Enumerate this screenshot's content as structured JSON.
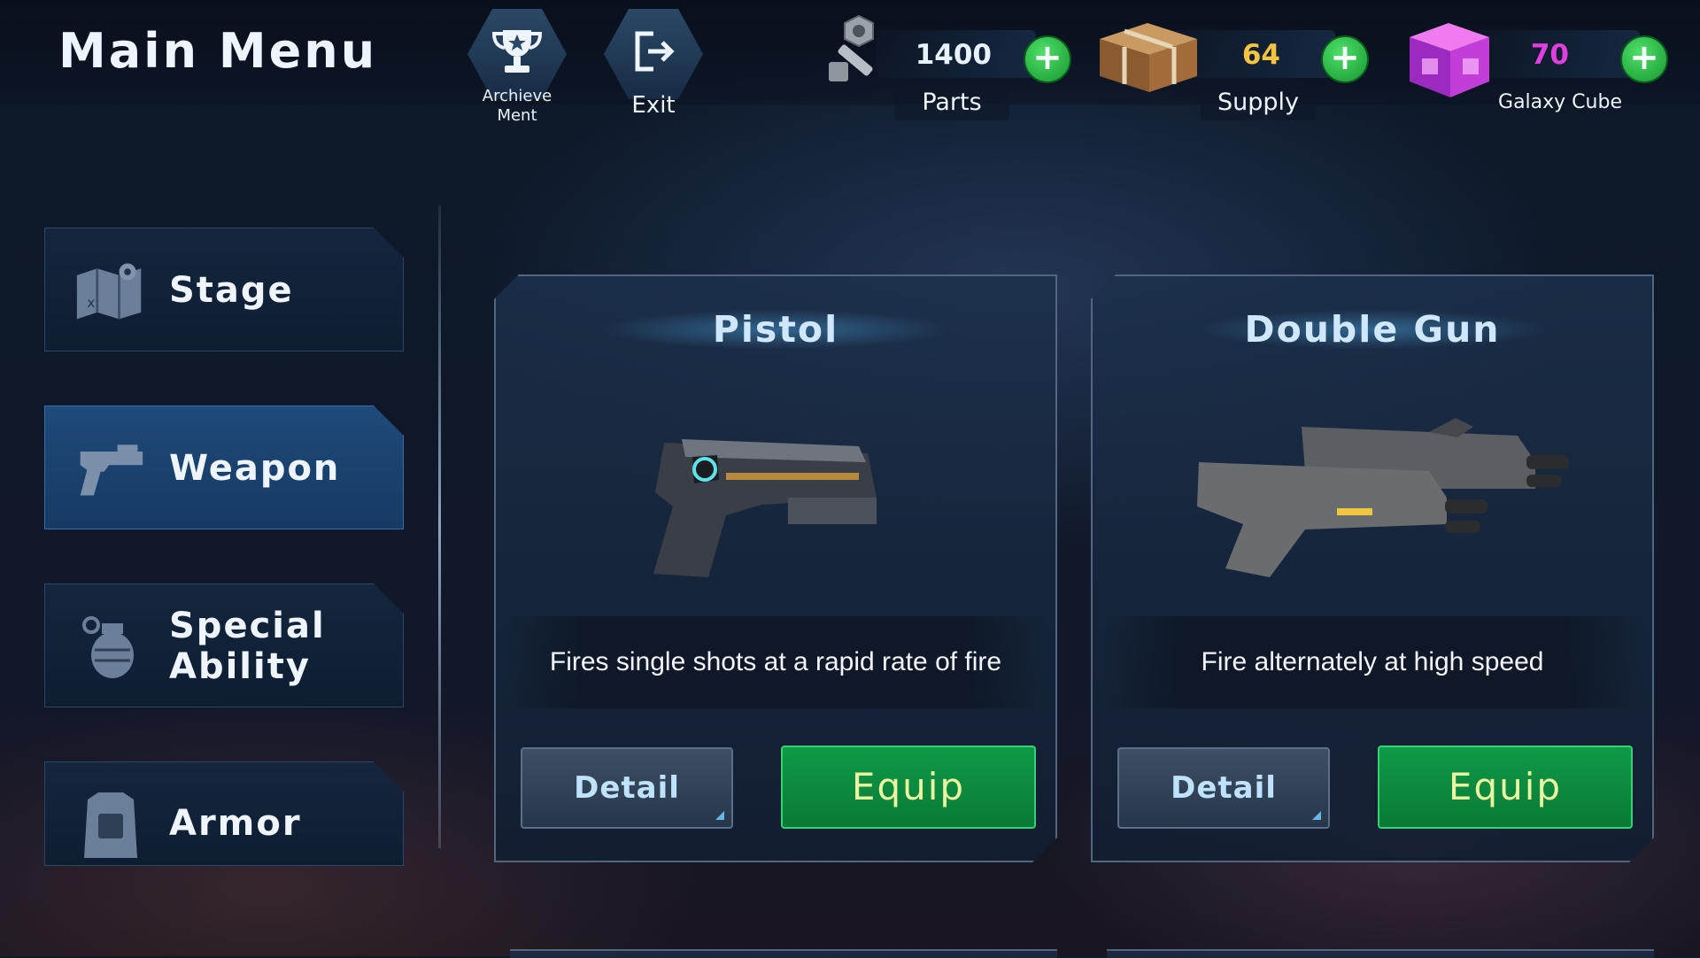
{
  "header": {
    "title": "Main Menu"
  },
  "top_buttons": [
    {
      "label": "Archieve\nMent",
      "icon": "trophy-icon"
    },
    {
      "label": "Exit",
      "icon": "exit-icon"
    }
  ],
  "resources": [
    {
      "name": "Parts",
      "value": "1400",
      "icon": "bolt-nut-icon",
      "value_color": "#ffffff"
    },
    {
      "name": "Supply",
      "value": "64",
      "icon": "supply-crate-icon",
      "value_color": "#f5c542"
    },
    {
      "name": "Galaxy Cube",
      "value": "70",
      "icon": "galaxy-cube-icon",
      "value_color": "#e040e0"
    }
  ],
  "sidebar": {
    "items": [
      {
        "label": "Stage",
        "icon": "map-icon",
        "active": false
      },
      {
        "label": "Weapon",
        "icon": "pistol-icon",
        "active": true
      },
      {
        "label": "Special\nAbility",
        "icon": "grenade-icon",
        "active": false
      },
      {
        "label": "Armor",
        "icon": "vest-icon",
        "active": false
      }
    ]
  },
  "weapons": [
    {
      "name": "Pistol",
      "description": "Fires single shots at a rapid rate of fire",
      "detail_label": "Detail",
      "equip_label": "Equip"
    },
    {
      "name": "Double Gun",
      "description": "Fire alternately at high speed",
      "detail_label": "Detail",
      "equip_label": "Equip"
    }
  ],
  "colors": {
    "equip_green": "#0f9a47",
    "active_tab": "#1f4a7a",
    "accent_cyan": "#5fe3e8"
  }
}
